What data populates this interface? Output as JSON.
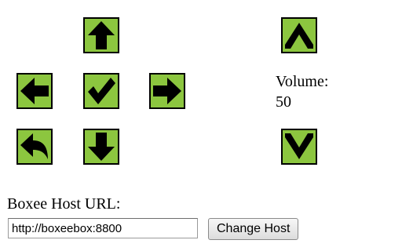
{
  "controls": {
    "up_icon": "arrow-up-icon",
    "left_icon": "arrow-left-icon",
    "ok_icon": "checkmark-icon",
    "right_icon": "arrow-right-icon",
    "back_icon": "back-arrow-icon",
    "down_icon": "arrow-down-icon",
    "button_color": "#8cc63f",
    "border_color": "#000000"
  },
  "volume": {
    "label": "Volume:",
    "value": "50",
    "up_icon": "chevron-up-icon",
    "down_icon": "chevron-down-icon"
  },
  "host": {
    "label": "Boxee Host URL:",
    "input_value": "http://boxeebox:8800",
    "button_label": "Change Host"
  }
}
